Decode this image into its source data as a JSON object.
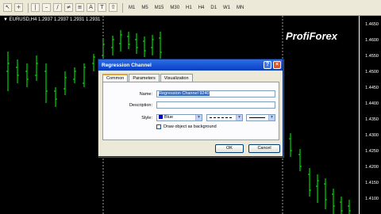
{
  "toolbar": {
    "timeframes": [
      "M1",
      "M5",
      "M15",
      "M30",
      "H1",
      "H4",
      "D1",
      "W1",
      "MN"
    ]
  },
  "chart": {
    "symbol_label": "EURUSD,H4  1.2937 1.2937 1.2931 1.2931",
    "brand": "ProfiForex",
    "price_ticks": [
      "1.4650",
      "1.4600",
      "1.4550",
      "1.4500",
      "1.4450",
      "1.4400",
      "1.4350",
      "1.4300",
      "1.4250",
      "1.4200",
      "1.4150",
      "1.4100"
    ]
  },
  "dialog": {
    "title": "Regression Channel",
    "help_label": "?",
    "close_label": "×",
    "tabs": [
      {
        "label": "Common",
        "active": true
      },
      {
        "label": "Parameters",
        "active": false
      },
      {
        "label": "Visualization",
        "active": false
      }
    ],
    "name_label": "Name:",
    "name_value": "Regression Channel 9240",
    "description_label": "Description:",
    "description_value": "",
    "style_label": "Style:",
    "color_value": "Blue",
    "color_hex": "#0000cc",
    "draw_background_label": "Draw object as background",
    "draw_background_checked": false,
    "ok_label": "OK",
    "cancel_label": "Cancel"
  },
  "colors": {
    "candle": "#00ff00",
    "background": "#000000",
    "dialog_face": "#ece9d8",
    "title_bar": "#0a3ec4"
  }
}
